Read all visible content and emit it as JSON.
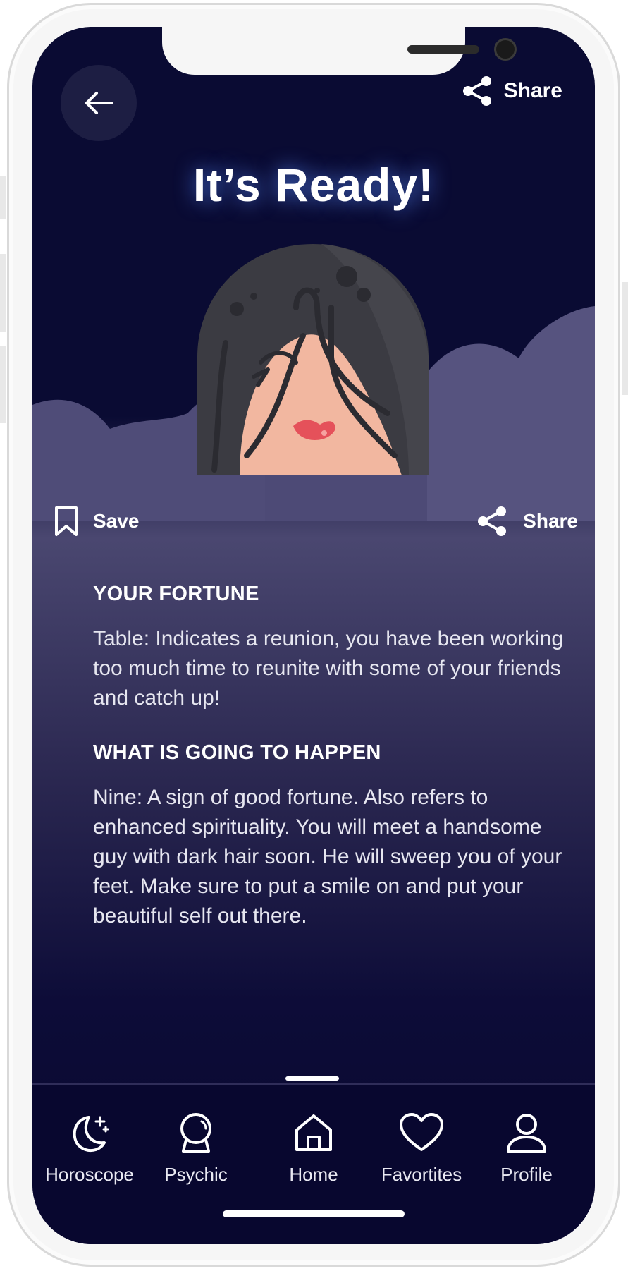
{
  "header": {
    "share_label": "Share"
  },
  "title": "It’s Ready!",
  "actions": {
    "save_label": "Save",
    "share_label": "Share"
  },
  "sections": [
    {
      "heading": "YOUR FORTUNE",
      "text": "Table: Indicates a reunion, you have been working too much time to reunite with some of your friends and catch up!"
    },
    {
      "heading": "WHAT IS GOING TO HAPPEN",
      "text": "Nine: A sign of good fortune. Also refers to enhanced spirituality. You will meet a handsome guy with dark hair soon. He will sweep you of your feet. Make sure to put a smile on and put your beautiful self out there."
    }
  ],
  "tabs": [
    {
      "label": "Horoscope",
      "icon": "moon-stars-icon"
    },
    {
      "label": "Psychic",
      "icon": "crystal-ball-icon"
    },
    {
      "label": "Home",
      "icon": "home-icon",
      "active": true
    },
    {
      "label": "Favortites",
      "icon": "heart-icon"
    },
    {
      "label": "Profile",
      "icon": "user-icon"
    }
  ],
  "colors": {
    "background_top": "#0a0b33",
    "cloud": "#55527d",
    "tabbar": "#08072f",
    "text": "#ffffff"
  }
}
